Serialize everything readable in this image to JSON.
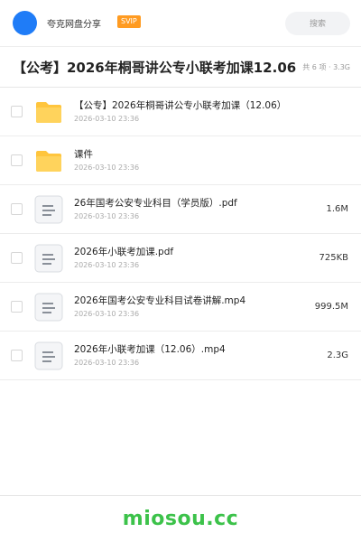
{
  "header": {
    "brand": "夸克网盘分享",
    "badge": "SVIP",
    "search_placeholder": "搜索"
  },
  "share": {
    "title": "【公考】2026年桐哥讲公专小联考加课12.06",
    "meta": "共 6 项 · 3.3G"
  },
  "files": [
    {
      "type": "folder-icon",
      "name": "【公专】2026年桐哥讲公专小联考加课（12.06）",
      "date": "2026-03-10 23:36",
      "size": ""
    },
    {
      "type": "folder-icon",
      "name": "课件",
      "date": "2026-03-10 23:36",
      "size": ""
    },
    {
      "type": "file-icon",
      "name": "26年国考公安专业科目（学员版）.pdf",
      "date": "2026-03-10 23:36",
      "size": "1.6M"
    },
    {
      "type": "file-icon",
      "name": "2026年小联考加课.pdf",
      "date": "2026-03-10 23:36",
      "size": "725KB"
    },
    {
      "type": "file-icon",
      "name": "2026年国考公安专业科目试卷讲解.mp4",
      "date": "2026-03-10 23:36",
      "size": "999.5M"
    },
    {
      "type": "file-icon",
      "name": "2026年小联考加课（12.06）.mp4",
      "date": "2026-03-10 23:36",
      "size": "2.3G"
    }
  ],
  "footer": {
    "brand": "miosou.cc"
  },
  "colors": {
    "avatar": "#1f7cf7",
    "badge": "#ff9b21",
    "folder": "#ffc53d",
    "footer_brand": "#3cc24a"
  }
}
